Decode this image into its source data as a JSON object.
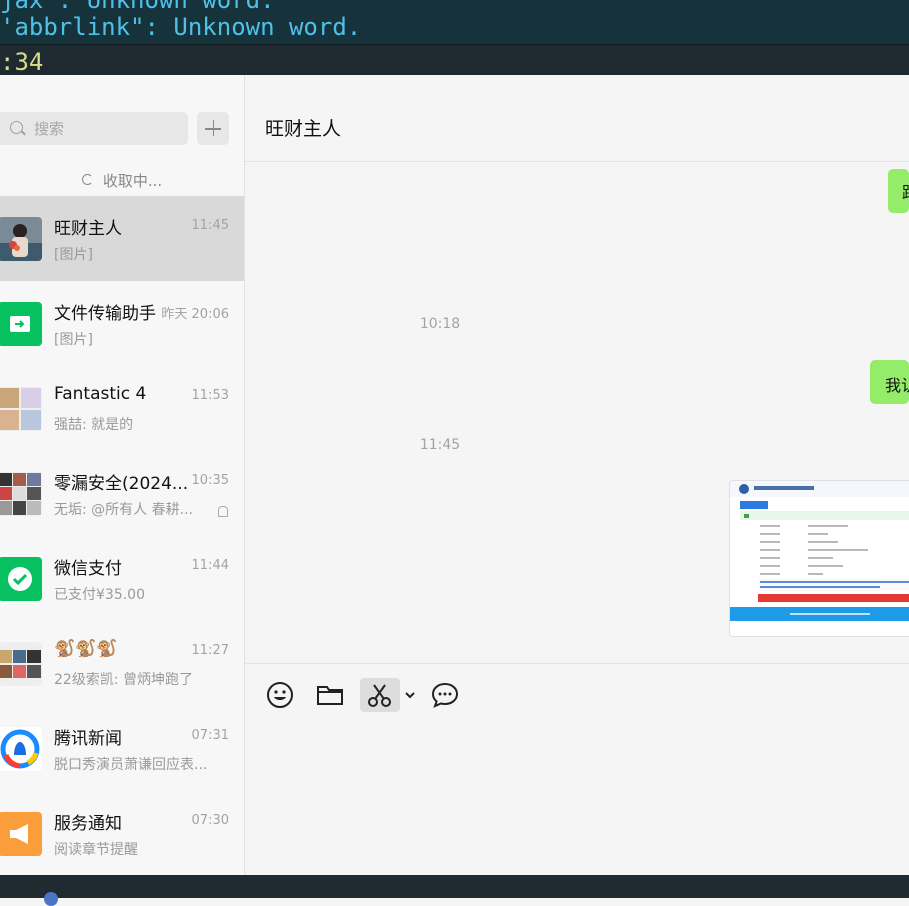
{
  "terminal": {
    "line1": "jax\": Unknown word.",
    "line2": "'abbrlink\": Unknown word.",
    "line3": ":34"
  },
  "sidebar": {
    "search_placeholder": "搜索",
    "loading_text": "收取中...",
    "conversations": [
      {
        "name": "旺财主人",
        "time": "11:45",
        "preview": "[图片]",
        "active": true
      },
      {
        "name": "文件传输助手",
        "time": "昨天 20:06",
        "preview": "[图片]"
      },
      {
        "name": "Fantastic 4",
        "time": "11:53",
        "preview": "强喆: 就是的"
      },
      {
        "name": "零漏安全(2024...",
        "time": "10:35",
        "preview": "无垢: @所有人 春耕...",
        "muted": true
      },
      {
        "name": "微信支付",
        "time": "11:44",
        "preview": "已支付¥35.00"
      },
      {
        "name": "🐒🐒🐒",
        "time": "11:27",
        "preview": "22级索凯: 曾炳坤跑了"
      },
      {
        "name": "腾讯新闻",
        "time": "07:31",
        "preview": "脱口秀演员萧谦回应表..."
      },
      {
        "name": "服务通知",
        "time": "07:30",
        "preview": "阅读章节提醒"
      }
    ]
  },
  "chat": {
    "title": "旺财主人",
    "bubble1": "跟",
    "timestamp1": "10:18",
    "bubble2": "我认",
    "timestamp2": "11:45"
  },
  "toolbar": {
    "icons": [
      "emoji-icon",
      "folder-icon",
      "scissors-icon",
      "chat-bubble-icon"
    ]
  },
  "colors": {
    "bubble_green": "#95ec69",
    "wechat_green": "#07c160",
    "terminal_bg": "#16323b"
  }
}
